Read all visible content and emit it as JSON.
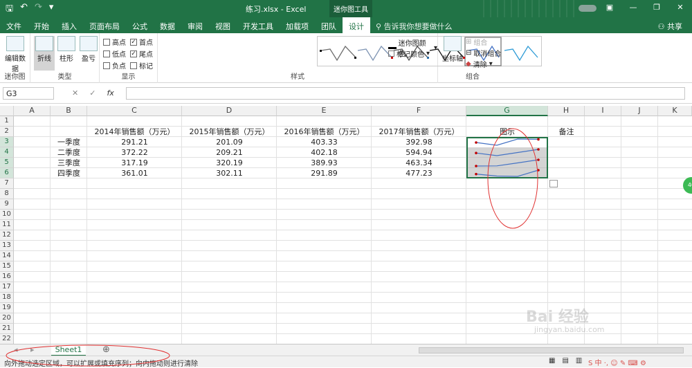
{
  "title_bar": {
    "title": "练习.xlsx - Excel",
    "context_tool": "迷你图工具"
  },
  "tabs": [
    "文件",
    "开始",
    "插入",
    "页面布局",
    "公式",
    "数据",
    "审阅",
    "视图",
    "开发工具",
    "加载项",
    "团队",
    "设计"
  ],
  "tell_me": "告诉我你想要做什么",
  "share": "共享",
  "ribbon": {
    "sparkline_group": {
      "button": "编辑数据",
      "label": "迷你图"
    },
    "type_group": {
      "buttons": [
        "折线",
        "柱形",
        "盈亏"
      ],
      "label": "类型"
    },
    "show_group": {
      "label": "显示",
      "checks": [
        {
          "text": "高点",
          "checked": false
        },
        {
          "text": "首点",
          "checked": true
        },
        {
          "text": "低点",
          "checked": false
        },
        {
          "text": "尾点",
          "checked": true
        },
        {
          "text": "负点",
          "checked": false
        },
        {
          "text": "标记",
          "checked": false
        }
      ]
    },
    "style_group": {
      "label": "样式",
      "sparkline_color": "迷你图颜色",
      "marker_color": "标记颜色"
    },
    "group_group": {
      "label": "组合",
      "axis": "坐标轴",
      "group": "组合",
      "ungroup": "取消组合",
      "clear": "清除"
    }
  },
  "formula_bar": {
    "name_box": "G3",
    "fx": "fx"
  },
  "columns": [
    "A",
    "B",
    "C",
    "D",
    "E",
    "F",
    "G",
    "H",
    "I",
    "J",
    "K"
  ],
  "rows": [
    "1",
    "2",
    "3",
    "4",
    "5",
    "6",
    "7",
    "8",
    "9",
    "10",
    "11",
    "12",
    "13",
    "14",
    "15",
    "16",
    "17",
    "18",
    "19",
    "20",
    "21",
    "22"
  ],
  "headers": {
    "c": "2014年销售额（万元）",
    "d": "2015年销售额（万元）",
    "e": "2016年销售额（万元）",
    "f": "2017年销售额（万元）",
    "g": "图示",
    "h": "备注"
  },
  "table": [
    {
      "q": "一季度",
      "v": [
        "291.21",
        "201.09",
        "403.33",
        "392.98"
      ]
    },
    {
      "q": "二季度",
      "v": [
        "372.22",
        "209.21",
        "402.18",
        "594.94"
      ]
    },
    {
      "q": "三季度",
      "v": [
        "317.19",
        "320.19",
        "389.93",
        "463.34"
      ]
    },
    {
      "q": "四季度",
      "v": [
        "361.01",
        "302.11",
        "291.89",
        "477.23"
      ]
    }
  ],
  "sheet_tab": "Sheet1",
  "status": "向外拖动选定区域，可以扩展或填充序列；向内拖动则进行清除",
  "watermark": "Bai 经验",
  "watermark_url": "jingyan.baidu.com",
  "side_badge": "40",
  "colors": {
    "accent": "#217346",
    "sparkline": "#4472c4",
    "marker": "#c00000"
  }
}
